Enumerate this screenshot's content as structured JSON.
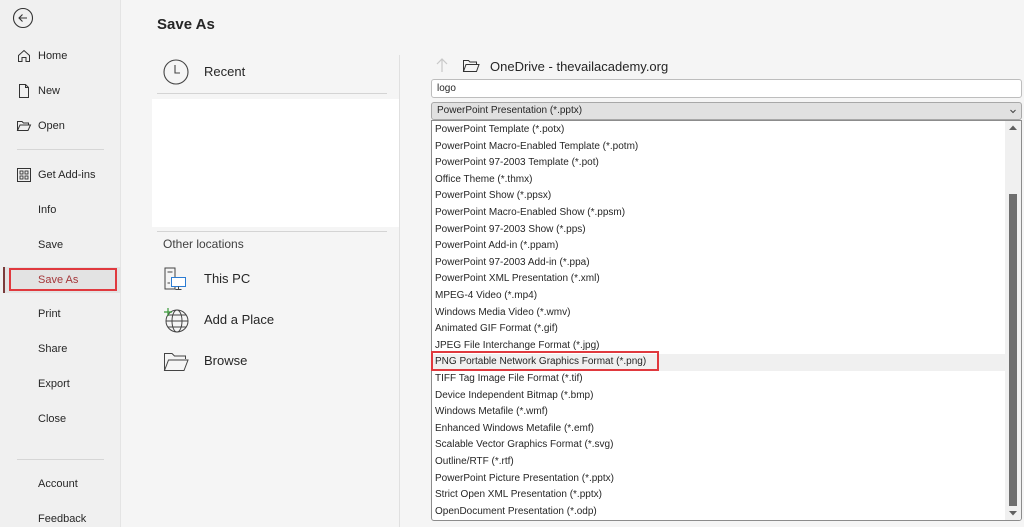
{
  "sidebar": {
    "back_icon": "back-arrow-circle-icon",
    "items": [
      {
        "label": "Home",
        "icon": "home-icon"
      },
      {
        "label": "New",
        "icon": "new-document-icon"
      },
      {
        "label": "Open",
        "icon": "open-folder-icon"
      },
      {
        "label": "Get Add-ins",
        "icon": "add-ins-grid-icon"
      },
      {
        "label": "Info"
      },
      {
        "label": "Save"
      },
      {
        "label": "Save As",
        "selected": true
      },
      {
        "label": "Print"
      },
      {
        "label": "Share"
      },
      {
        "label": "Export"
      },
      {
        "label": "Close"
      },
      {
        "label": "Account"
      },
      {
        "label": "Feedback"
      }
    ],
    "accent_color": "#a4373a",
    "highlight_color": "#e0393e"
  },
  "main": {
    "title": "Save As",
    "recent": {
      "label": "Recent",
      "icon": "clock-icon"
    },
    "other_locations_heading": "Other locations",
    "locations": [
      {
        "label": "This PC",
        "icon": "this-pc-icon"
      },
      {
        "label": "Add a Place",
        "icon": "add-place-globe-icon"
      },
      {
        "label": "Browse",
        "icon": "browse-folder-icon"
      }
    ]
  },
  "save_panel": {
    "location": "OneDrive - thevailacademy.org",
    "filename": "logo",
    "selected_file_type": "PowerPoint Presentation (*.pptx)",
    "file_type_options": [
      "PowerPoint Template (*.potx)",
      "PowerPoint Macro-Enabled Template (*.potm)",
      "PowerPoint 97-2003 Template (*.pot)",
      "Office Theme (*.thmx)",
      "PowerPoint Show (*.ppsx)",
      "PowerPoint Macro-Enabled Show (*.ppsm)",
      "PowerPoint 97-2003 Show (*.pps)",
      "PowerPoint Add-in (*.ppam)",
      "PowerPoint 97-2003 Add-in (*.ppa)",
      "PowerPoint XML Presentation (*.xml)",
      "MPEG-4 Video (*.mp4)",
      "Windows Media Video (*.wmv)",
      "Animated GIF Format (*.gif)",
      "JPEG File Interchange Format (*.jpg)",
      "PNG Portable Network Graphics Format (*.png)",
      "TIFF Tag Image File Format (*.tif)",
      "Device Independent Bitmap (*.bmp)",
      "Windows Metafile (*.wmf)",
      "Enhanced Windows Metafile (*.emf)",
      "Scalable Vector Graphics Format (*.svg)",
      "Outline/RTF (*.rtf)",
      "PowerPoint Picture Presentation (*.pptx)",
      "Strict Open XML Presentation (*.pptx)",
      "OpenDocument Presentation (*.odp)"
    ],
    "hovered_option_index": 14,
    "scroll_position_fraction": 0.25
  }
}
